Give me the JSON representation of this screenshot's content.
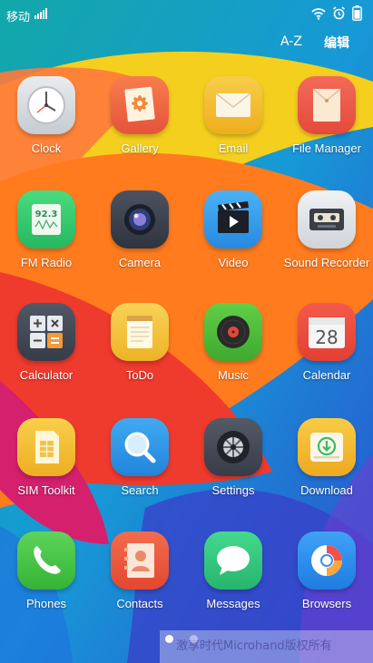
{
  "status_bar": {
    "carrier": "移动"
  },
  "top_bar": {
    "sort_label": "A-Z",
    "edit_label": "编辑"
  },
  "apps": [
    {
      "label": "Clock",
      "icon": "clock-icon",
      "color": "#ffffff"
    },
    {
      "label": "Gallery",
      "icon": "gallery-icon",
      "color": "#f06a45"
    },
    {
      "label": "Email",
      "icon": "email-icon",
      "color": "#f3c232"
    },
    {
      "label": "File Manager",
      "icon": "file-manager-icon",
      "color": "#ef5b4b"
    },
    {
      "label": "FM Radio",
      "icon": "fm-radio-icon",
      "color": "#3cd173"
    },
    {
      "label": "Camera",
      "icon": "camera-icon",
      "color": "#3d4553"
    },
    {
      "label": "Video",
      "icon": "video-icon",
      "color": "#3aa6ef"
    },
    {
      "label": "Sound Recorder",
      "icon": "sound-recorder-icon",
      "color": "#e3e6ea"
    },
    {
      "label": "Calculator",
      "icon": "calculator-icon",
      "color": "#434955"
    },
    {
      "label": "ToDo",
      "icon": "todo-icon",
      "color": "#f6c641"
    },
    {
      "label": "Music",
      "icon": "music-icon",
      "color": "#53c23a"
    },
    {
      "label": "Calendar",
      "icon": "calendar-icon",
      "color": "#f2f2f2"
    },
    {
      "label": "SIM Toolkit",
      "icon": "sim-toolkit-icon",
      "color": "#f5c53a"
    },
    {
      "label": "Search",
      "icon": "search-icon",
      "color": "#2f9be8"
    },
    {
      "label": "Settings",
      "icon": "settings-icon",
      "color": "#454b55"
    },
    {
      "label": "Download",
      "icon": "download-icon",
      "color": "#f5c02e"
    },
    {
      "label": "Phones",
      "icon": "phone-icon",
      "color": "#47c745"
    },
    {
      "label": "Contacts",
      "icon": "contacts-icon",
      "color": "#ee5a3f"
    },
    {
      "label": "Messages",
      "icon": "messages-icon",
      "color": "#36cd82"
    },
    {
      "label": "Browsers",
      "icon": "browser-icon",
      "color": "#2d8ff0"
    }
  ],
  "widgets": {
    "fm_frequency": "92.3",
    "calendar_day": "28"
  },
  "watermark": "激享时代Microhand版权所有"
}
